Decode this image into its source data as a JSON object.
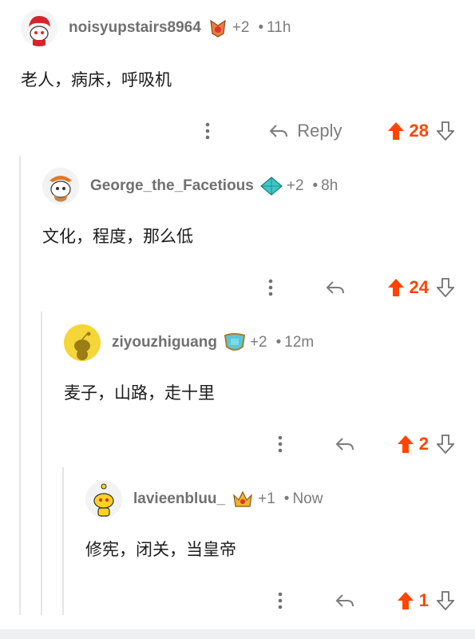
{
  "comments": [
    {
      "username": "noisyupstairs8964",
      "awards": "+2",
      "time": "11h",
      "body": "老人，病床，呼吸机",
      "reply": "Reply",
      "score": "28",
      "avatar": "snoo-avatar-red-hair",
      "award_icon": "fire-award-icon"
    },
    {
      "username": "George_the_Facetious",
      "awards": "+2",
      "time": "8h",
      "body": "文化，程度，那么低",
      "reply": "",
      "score": "24",
      "avatar": "snoo-avatar-pirate",
      "award_icon": "diamond-award-icon"
    },
    {
      "username": "ziyouzhiguang",
      "awards": "+2",
      "time": "12m",
      "body": "麦子，山路，走十里",
      "reply": "",
      "score": "2",
      "avatar": "default-snoo-avatar-yellow",
      "award_icon": "shield-award-icon"
    },
    {
      "username": "lavieenbluu_",
      "awards": "+1",
      "time": "Now",
      "body": "修宪，闭关，当皇帝",
      "reply": "",
      "score": "1",
      "avatar": "snoo-avatar-yellow",
      "award_icon": "crown-award-icon"
    }
  ],
  "colors": {
    "upvote": "#ff4500",
    "meta": "#7c7c7c",
    "thread_line": "#e6e6e6"
  }
}
